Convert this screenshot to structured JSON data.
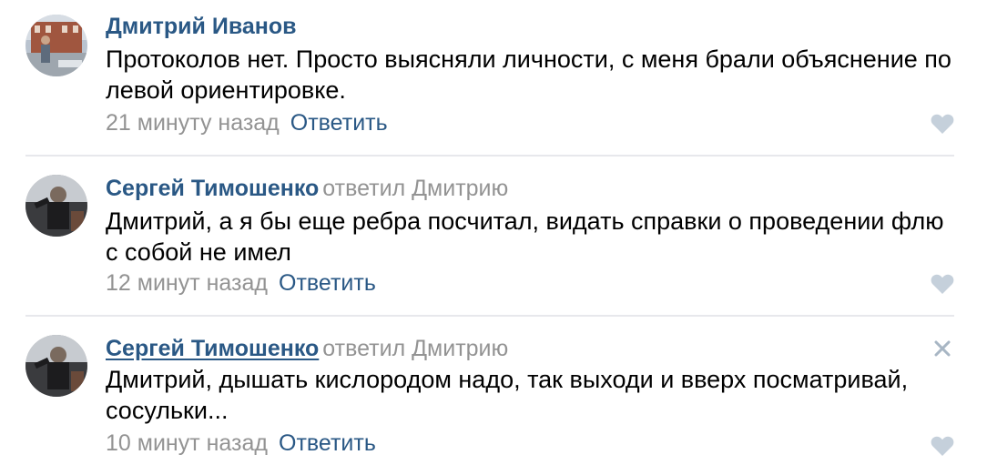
{
  "colors": {
    "link": "#2a5885",
    "muted": "#939393",
    "divider": "#e7e8ec",
    "like_icon": "#c5d0db"
  },
  "comments": [
    {
      "author": "Дмитрий Иванов",
      "reply_to": "",
      "text": "Протоколов нет. Просто выясняли личности, с меня брали объяснение по левой ориентировке.",
      "time": "21 минуту назад",
      "reply_label": "Ответить",
      "icons": [
        "avatar",
        "heart-icon"
      ]
    },
    {
      "author": "Сергей Тимошенко",
      "reply_to": "ответил Дмитрию",
      "text": "Дмитрий, а я бы еще ребра посчитал, видать справки о проведении флю с собой не имел",
      "time": "12 минут назад",
      "reply_label": "Ответить",
      "icons": [
        "avatar",
        "heart-icon"
      ]
    },
    {
      "author": "Сергей Тимошенко",
      "reply_to": "ответил Дмитрию",
      "text": "Дмитрий, дышать кислородом надо, так выходи и вверх посматривай, сосульки...",
      "time": "10 минут назад",
      "reply_label": "Ответить",
      "icons": [
        "avatar",
        "heart-icon",
        "close-icon"
      ]
    }
  ]
}
